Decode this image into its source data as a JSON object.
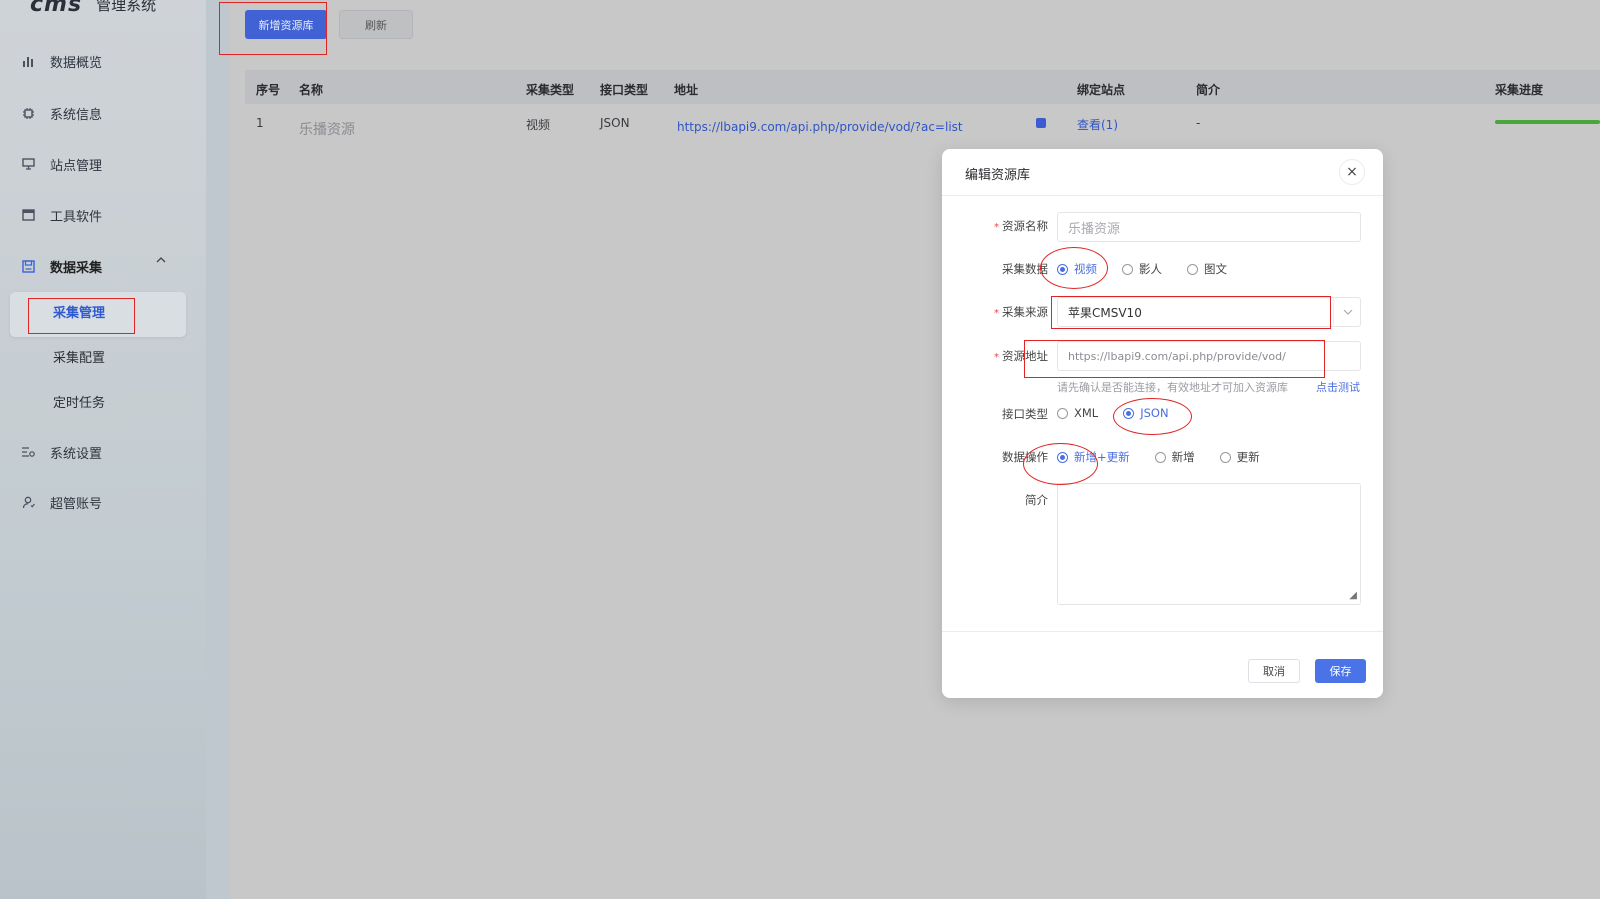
{
  "app": {
    "logo": "cms",
    "title": "管理系统"
  },
  "sidebar": {
    "items": [
      {
        "label": "数据概览",
        "icon": "bar-chart-icon"
      },
      {
        "label": "系统信息",
        "icon": "chip-icon"
      },
      {
        "label": "站点管理",
        "icon": "monitor-icon"
      },
      {
        "label": "工具软件",
        "icon": "window-icon"
      },
      {
        "label": "数据采集",
        "icon": "save-icon"
      },
      {
        "label": "系统设置",
        "icon": "settings-sliders-icon"
      },
      {
        "label": "超管账号",
        "icon": "user-icon"
      }
    ],
    "submenu": [
      {
        "label": "采集管理"
      },
      {
        "label": "采集配置"
      },
      {
        "label": "定时任务"
      }
    ]
  },
  "toolbar": {
    "add_label": "新增资源库",
    "refresh_label": "刷新"
  },
  "table": {
    "headers": [
      "序号",
      "名称",
      "采集类型",
      "接口类型",
      "地址",
      "绑定站点",
      "简介",
      "采集进度"
    ],
    "rows": [
      {
        "index": "1",
        "name": "乐播资源",
        "type": "视频",
        "api": "JSON",
        "url": "https://lbapi9.com/api.php/provide/vod/?ac=list",
        "bind": "查看(1)",
        "desc": "-",
        "progress": 1.0
      }
    ]
  },
  "modal": {
    "title": "编辑资源库",
    "close": "×",
    "name_label": "资源名称",
    "name_placeholder": "乐播资源",
    "data_label": "采集数据",
    "data_options": [
      "视频",
      "影人",
      "图文"
    ],
    "source_label": "采集来源",
    "source_value": "苹果CMSV10",
    "url_label": "资源地址",
    "url_value": "https://lbapi9.com/api.php/provide/vod/",
    "hint": "请先确认是否能连接，有效地址才可加入资源库",
    "test_link": "点击测试",
    "api_label": "接口类型",
    "api_options": [
      "XML",
      "JSON"
    ],
    "op_label": "数据操作",
    "op_options": [
      "新增+更新",
      "新增",
      "更新"
    ],
    "desc_label": "简介",
    "cancel": "取消",
    "save": "保存"
  },
  "colors": {
    "primary": "#4162d4",
    "annotation": "#e02424",
    "progress": "#4aa53a"
  }
}
